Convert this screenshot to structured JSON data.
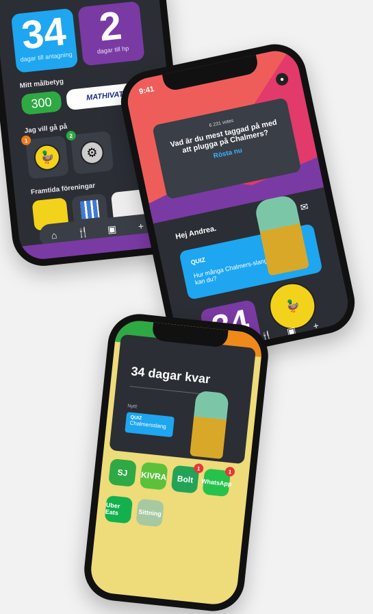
{
  "phone1": {
    "days_to_admission": "34",
    "days_to_admission_label": "dagar till antagning",
    "days_to_hp": "2",
    "days_to_hp_label": "dagar till hp",
    "goal_grade_label": "Mitt målbetyg",
    "goal_grade_value": "300",
    "brand_label": "MATHIVATI○N",
    "going_label": "Jag vill gå på",
    "badge_1": "1",
    "badge_2": "2",
    "future_label": "Framtida föreningar",
    "tab_icons": [
      "home-icon",
      "food-icon",
      "calendar-icon",
      "plus-icon"
    ]
  },
  "phone2": {
    "time": "9:41",
    "votes": "6 231 votes",
    "question": "Vad är du mest taggad på med att plugga på Chalmers?",
    "vote_button": "Rösta nu",
    "greeting": "Hej Andrea.",
    "quiz_tag": "QUIZ",
    "quiz_question": "Hur många Chalmers-slang kan du?",
    "days_big": "34",
    "colors": {
      "red": "#ef5d5a",
      "purple": "#7a3aa3",
      "blue": "#1ea6f0"
    }
  },
  "phone3": {
    "title": "34 dagar kvar",
    "new_label": "Nytt!",
    "quiz_tag": "QUIZ",
    "quiz_sub": "Chalmersslang",
    "apps": [
      {
        "name": "SJ",
        "color": "#2fa944",
        "badge": ""
      },
      {
        "name": "KIVRA",
        "color": "#5cc13a",
        "badge": ""
      },
      {
        "name": "Bolt",
        "color": "#23a356",
        "badge": "1"
      },
      {
        "name": "WhatsApp",
        "color": "#27c24c",
        "badge": "1"
      },
      {
        "name": "Uber Eats",
        "color": "#14b04e",
        "badge": ""
      },
      {
        "name": "Sittning",
        "color": "#a7c9a2",
        "badge": ""
      }
    ]
  }
}
